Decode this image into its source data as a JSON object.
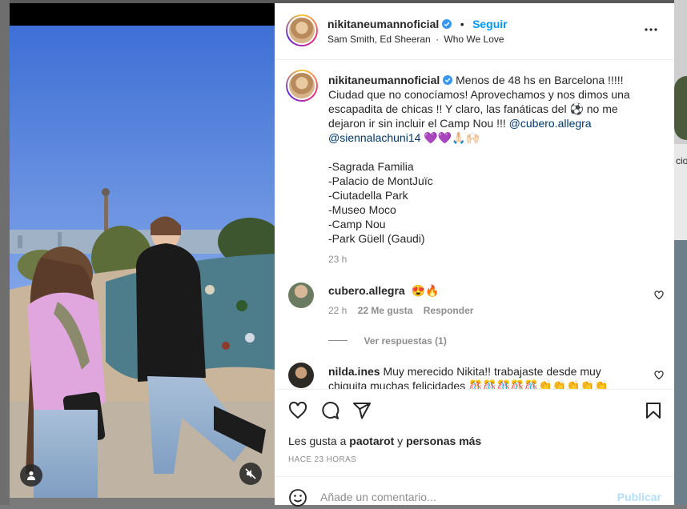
{
  "post": {
    "author": "nikitaneumannoficial",
    "follow_label": "Seguir",
    "separator": "•",
    "audio_artists": "Sam Smith, Ed Sheeran",
    "audio_separator": "·",
    "audio_title": "Who We Love",
    "caption_author": "nikitaneumannoficial",
    "caption_lines": [
      "Menos de 48 hs en Barcelona !!!!!",
      "Ciudad que no conocíamos! Aprovechamos y nos dimos una",
      "escapadita de chicas !! Y claro, las fanáticas del ⚽ no me",
      "dejaron ir sin incluir el Camp Nou !!! "
    ],
    "mention_1": "@cubero.allegra",
    "mention_2": "@siennalachuni14",
    "caption_emojis": " 💜💜🙏🏻🙌🏻",
    "places": [
      "-Sagrada Familia",
      "-Palacio de MontJuïc",
      "-Ciutadella Park",
      "-Museo Moco",
      "-Camp Nou",
      "-Park Güell (Gaudi)"
    ],
    "caption_time": "23 h",
    "likes_prefix": "Les gusta a ",
    "likes_user": "paotarot",
    "likes_mid": " y ",
    "likes_rest": "personas más",
    "timestamp": "HACE 23 HORAS"
  },
  "comments": [
    {
      "user": "cubero.allegra",
      "text": "😍🔥",
      "time": "22 h",
      "likes": "22 Me gusta",
      "reply": "Responder",
      "view_replies": "Ver respuestas (1)"
    },
    {
      "user": "nilda.ines",
      "text": "Muy merecido Nikita!! trabajaste desde muy",
      "text2": "chiquita muchas felicidades 🎊🎊🎊🎊🎊👏👏👏👏👏"
    }
  ],
  "composer": {
    "placeholder": "Añade un comentario...",
    "publish": "Publicar"
  },
  "background": {
    "fragment": "cio"
  },
  "icons": {
    "verified": "verified-badge-icon",
    "more": "more-options-icon",
    "heart": "heart-icon",
    "comment": "comment-icon",
    "share": "share-icon",
    "save": "bookmark-icon",
    "emoji": "emoji-icon",
    "user_tag": "user-tag-icon",
    "mute": "muted-audio-icon"
  },
  "colors": {
    "link": "#00376b",
    "follow": "#0095f6",
    "publish_disabled": "#b2dffc",
    "muted_text": "#8e8e8e"
  }
}
